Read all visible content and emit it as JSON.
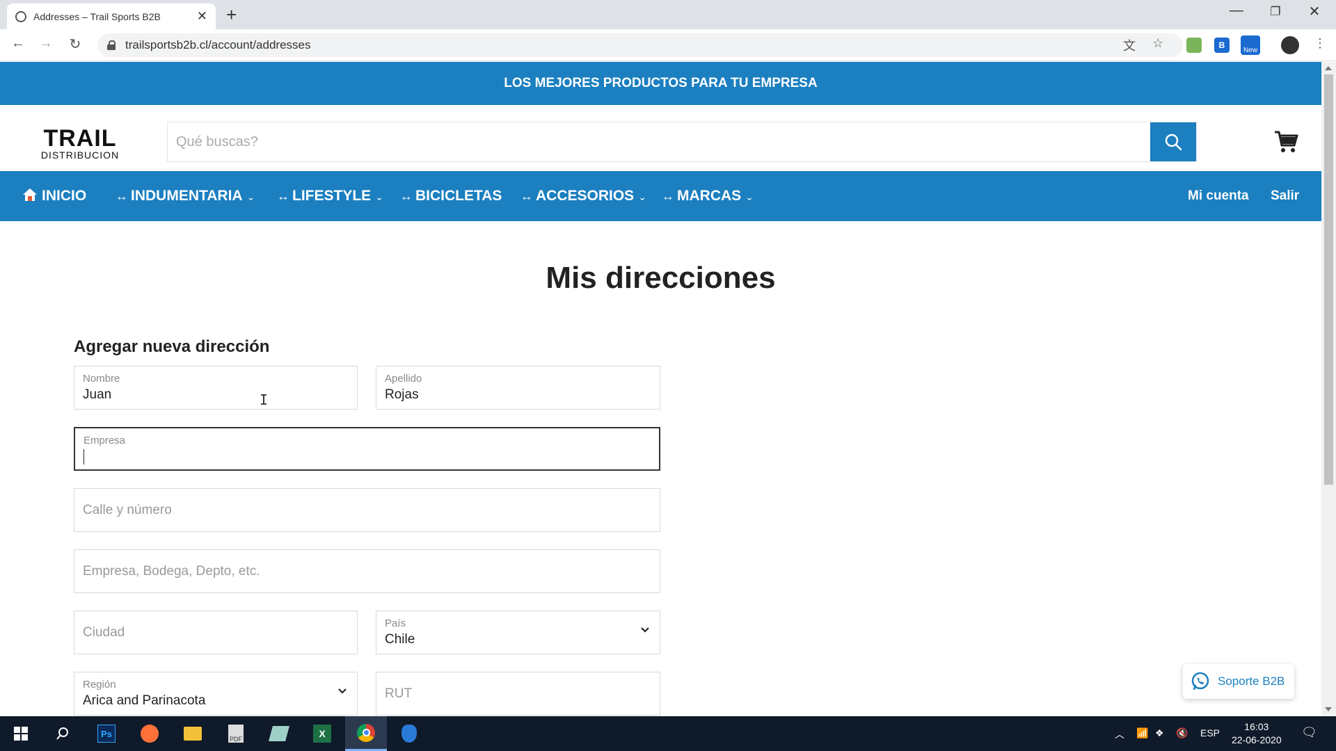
{
  "browser": {
    "tab_title": "Addresses – Trail Sports B2B",
    "url": "trailsportsb2b.cl/account/addresses",
    "new_tab_symbol": "+",
    "close_symbol": "✕",
    "ext_new_badge": "New"
  },
  "site": {
    "announcement": "LOS MEJORES PRODUCTOS PARA TU EMPRESA",
    "logo_main": "TRAIL",
    "logo_sub": "DISTRIBUCION",
    "search_placeholder": "Qué buscas?",
    "nav": {
      "home": "INICIO",
      "items": [
        {
          "label": "INDUMENTARIA",
          "has_dropdown": true
        },
        {
          "label": "LIFESTYLE",
          "has_dropdown": true
        },
        {
          "label": "BICICLETAS",
          "has_dropdown": false
        },
        {
          "label": "ACCESORIOS",
          "has_dropdown": true
        },
        {
          "label": "MARCAS",
          "has_dropdown": true
        }
      ],
      "account": "Mi cuenta",
      "logout": "Salir",
      "prefix_symbol": "↔",
      "dropdown_symbol": "⌄"
    }
  },
  "page": {
    "title": "Mis direcciones",
    "form_heading": "Agregar nueva dirección"
  },
  "form": {
    "first_name": {
      "label": "Nombre",
      "value": "Juan"
    },
    "last_name": {
      "label": "Apellido",
      "value": "Rojas"
    },
    "company": {
      "label": "Empresa",
      "value": ""
    },
    "street": {
      "placeholder": "Calle y número"
    },
    "address2": {
      "placeholder": "Empresa, Bodega, Depto, etc."
    },
    "city": {
      "placeholder": "Ciudad"
    },
    "country": {
      "label": "País",
      "value": "Chile"
    },
    "region": {
      "label": "Región",
      "value": "Arica and Parinacota"
    },
    "rut": {
      "placeholder": "RUT"
    }
  },
  "support": {
    "label": "Soporte B2B"
  },
  "taskbar": {
    "language": "ESP",
    "time": "16:03",
    "date": "22-06-2020"
  },
  "colors": {
    "brand_blue": "#1b7fc0",
    "whatsapp_blue": "#1b7fc0"
  }
}
